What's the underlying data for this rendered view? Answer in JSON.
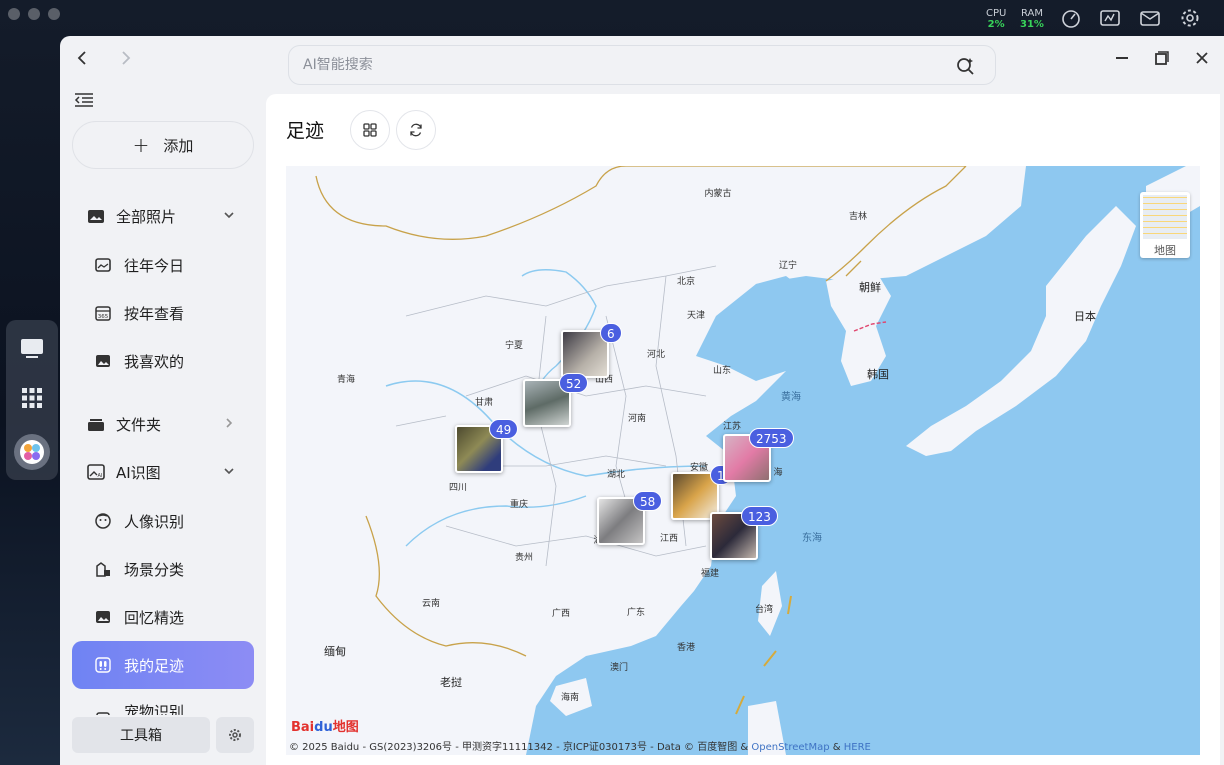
{
  "system": {
    "cpu_label": "CPU",
    "cpu_value": "2%",
    "ram_label": "RAM",
    "ram_value": "31%"
  },
  "search": {
    "placeholder": "AI智能搜索"
  },
  "sidebar": {
    "add_label": "添加",
    "all_photos": "全部照片",
    "sub_photos": [
      "往年今日",
      "按年查看",
      "我喜欢的"
    ],
    "folders": "文件夹",
    "ai": "AI识图",
    "sub_ai": [
      "人像识别",
      "场景分类",
      "回忆精选",
      "我的足迹",
      "宠物识别"
    ],
    "toolbox": "工具箱"
  },
  "main": {
    "title": "足迹"
  },
  "map": {
    "type_label": "地图",
    "labels": {
      "neimenggu": "内蒙古",
      "jilin": "吉林",
      "liaoning": "辽宁",
      "beijing": "北京",
      "tianjin": "天津",
      "hebei": "河北",
      "shanxi": "山西",
      "ningxia": "宁夏",
      "qinghai": "青海",
      "gansu": "甘肃",
      "shandong": "山东",
      "henan": "河南",
      "jiangsu": "江苏",
      "anhui": "安徽",
      "shanghai": "海",
      "hubei": "湖北",
      "sichuan": "四川",
      "chongqing": "重庆",
      "jiangxi": "江西",
      "guizhou": "贵州",
      "hunan": "湖",
      "fujian": "福建",
      "yunnan": "云南",
      "guangxi": "广西",
      "guangdong": "广东",
      "hongkong": "香港",
      "macau": "澳门",
      "taiwan": "台湾",
      "hainan": "海南",
      "chaoxian": "朝鲜",
      "hanguo": "韩国",
      "riben": "日本",
      "huanghai": "黄海",
      "donghai": "东海",
      "miandian": "缅甸",
      "laowo": "老挝"
    },
    "clusters": [
      "6",
      "52",
      "49",
      "58",
      "1",
      "2753",
      "123"
    ],
    "logo_bai": "Bai",
    "logo_du": "du",
    "logo_map": "地图",
    "copyright": "© 2025 Baidu - GS(2023)3206号 - 甲测资字11111342 - 京ICP证030173号 - Data © 百度智图 &",
    "osm": "OpenStreetMap",
    "amp": "&",
    "here": "HERE"
  }
}
